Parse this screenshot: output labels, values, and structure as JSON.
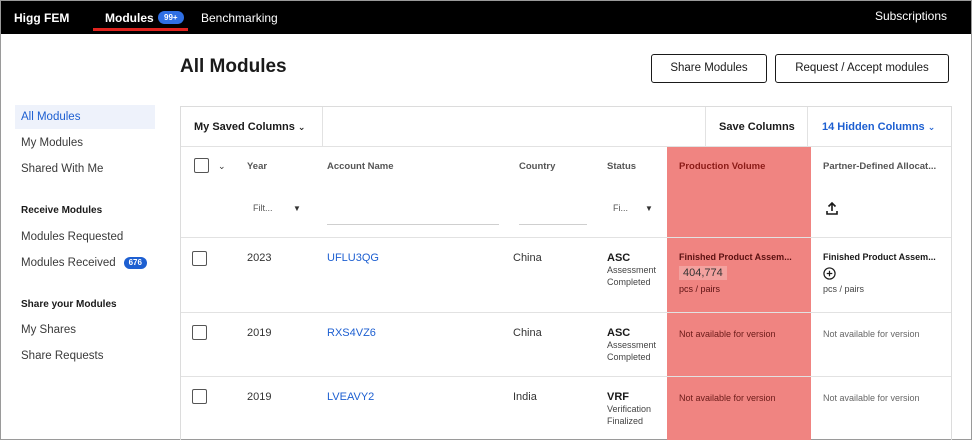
{
  "nav": {
    "brand": "Higg FEM",
    "modules_label": "Modules",
    "modules_badge": "99+",
    "benchmarking_label": "Benchmarking",
    "subscriptions_label": "Subscriptions"
  },
  "sidebar": {
    "items": [
      {
        "label": "All Modules",
        "active": true
      },
      {
        "label": "My Modules"
      },
      {
        "label": "Shared With Me"
      }
    ],
    "receive_heading": "Receive Modules",
    "receive_items": [
      {
        "label": "Modules Requested"
      },
      {
        "label": "Modules Received",
        "badge": "676"
      }
    ],
    "share_heading": "Share your Modules",
    "share_items": [
      {
        "label": "My Shares"
      },
      {
        "label": "Share Requests"
      }
    ]
  },
  "page": {
    "title": "All Modules",
    "share_button": "Share Modules",
    "request_button": "Request / Accept modules"
  },
  "toolbar": {
    "saved_columns": "My Saved Columns",
    "save_columns": "Save Columns",
    "hidden_columns": "14 Hidden Columns"
  },
  "columns": {
    "year": "Year",
    "account": "Account Name",
    "country": "Country",
    "status": "Status",
    "production_volume": "Production Volume",
    "partner_defined": "Partner-Defined Allocat..."
  },
  "filters": {
    "year": "Filt...",
    "status": "Fi..."
  },
  "rows": [
    {
      "year": "2023",
      "account": "UFLU3QG",
      "country": "China",
      "status": "ASC",
      "status_sub1": "Assessment",
      "status_sub2": "Completed",
      "pv_title": "Finished Product Assem...",
      "pv_value": "404,774",
      "pv_unit": "pcs / pairs",
      "pd_title": "Finished Product Assem...",
      "pd_unit": "pcs / pairs"
    },
    {
      "year": "2019",
      "account": "RXS4VZ6",
      "country": "China",
      "status": "ASC",
      "status_sub1": "Assessment",
      "status_sub2": "Completed",
      "pv_na": "Not available for version",
      "pd_na": "Not available for version"
    },
    {
      "year": "2019",
      "account": "LVEAVY2",
      "country": "India",
      "status": "VRF",
      "status_sub1": "Verification",
      "status_sub2": "Finalized",
      "pv_na": "Not available for version",
      "pd_na": "Not available for version"
    }
  ],
  "colors": {
    "accent": "#1d5fd1",
    "highlight_column": "#f08481",
    "nav_underline": "#e0241f"
  }
}
